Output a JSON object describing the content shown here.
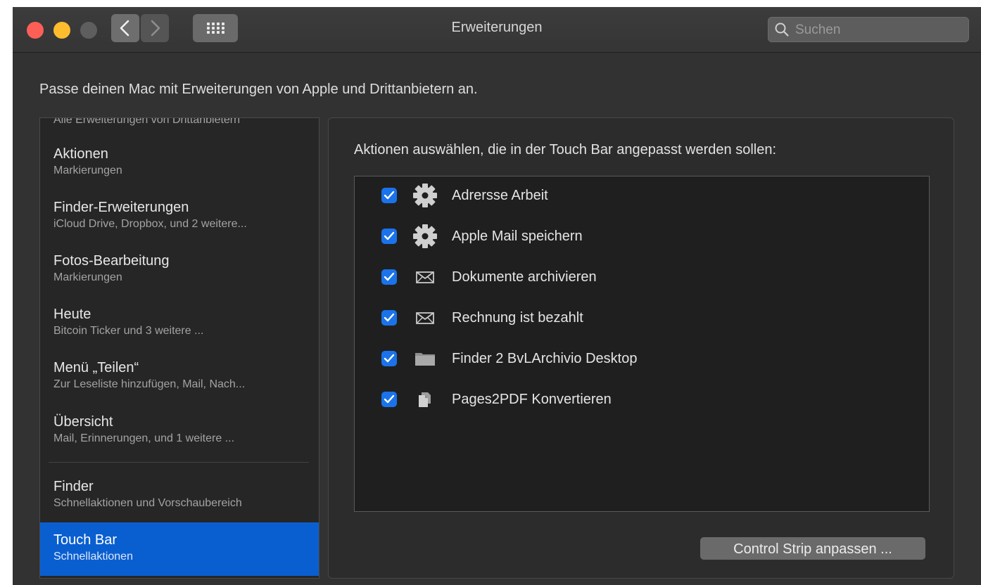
{
  "window": {
    "title": "Erweiterungen",
    "nav_back_icon": "chevron-left-icon",
    "nav_forward_icon": "chevron-right-icon",
    "grid_icon": "grid-icon"
  },
  "search": {
    "placeholder": "Suchen"
  },
  "intro": "Passe deinen Mac mit Erweiterungen von Apple und Drittanbietern an.",
  "sidebar": {
    "cut_item": "Alle Erweiterungen von Drittanbietern",
    "items": [
      {
        "title": "Aktionen",
        "subtitle": "Markierungen"
      },
      {
        "title": "Finder-Erweiterungen",
        "subtitle": "iCloud Drive, Dropbox, und 2 weitere..."
      },
      {
        "title": "Fotos-Bearbeitung",
        "subtitle": "Markierungen"
      },
      {
        "title": "Heute",
        "subtitle": "Bitcoin Ticker und 3 weitere ..."
      },
      {
        "title": "Menü „Teilen“",
        "subtitle": "Zur Leseliste hinzufügen, Mail, Nach..."
      },
      {
        "title": "Übersicht",
        "subtitle": "Mail, Erinnerungen, und 1 weitere ..."
      },
      {
        "title": "Finder",
        "subtitle": "Schnellaktionen und Vorschaubereich"
      },
      {
        "title": "Touch Bar",
        "subtitle": "Schnellaktionen",
        "selected": true
      }
    ]
  },
  "main": {
    "heading": "Aktionen auswählen, die in der Touch Bar angepasst werden sollen:",
    "actions": [
      {
        "label": "Adrersse Arbeit",
        "checked": true,
        "icon": "gear-icon"
      },
      {
        "label": "Apple Mail speichern",
        "checked": true,
        "icon": "gear-icon"
      },
      {
        "label": "Dokumente archivieren",
        "checked": true,
        "icon": "envelope-icon"
      },
      {
        "label": "Rechnung ist bezahlt",
        "checked": true,
        "icon": "envelope-icon"
      },
      {
        "label": "Finder 2 BvLArchivio Desktop",
        "checked": true,
        "icon": "folder-icon"
      },
      {
        "label": "Pages2PDF Konvertieren",
        "checked": true,
        "icon": "document-icon"
      }
    ],
    "control_strip_button": "Control Strip anpassen ..."
  },
  "colors": {
    "window_bg": "#323232",
    "accent": "#0a5fd0",
    "checkbox": "#1a73ea",
    "close": "#fd5f57",
    "minimize": "#febc2e"
  }
}
